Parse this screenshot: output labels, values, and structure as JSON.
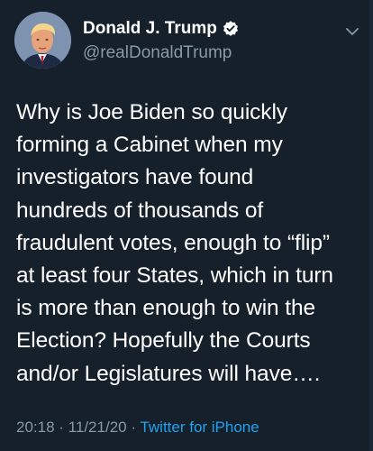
{
  "tweet": {
    "author": {
      "display_name": "Donald J. Trump",
      "handle": "@realDonaldTrump",
      "verified": true,
      "avatar_icon": "profile-photo"
    },
    "text_lines": [
      "Why is Joe Biden so quickly",
      "forming a Cabinet when my",
      "investigators have found",
      "hundreds of thousands of",
      "fraudulent votes, enough to “flip”",
      "at least four States, which in turn",
      "is more than enough to win the",
      "Election? Hopefully the Courts",
      "and/or Legislatures will have…."
    ],
    "time": "20:18",
    "date": "11/21/20",
    "separator": "·",
    "source": "Twitter for iPhone"
  },
  "colors": {
    "background": "#15202b",
    "text": "#ffffff",
    "secondary": "#8899a6",
    "link": "#1da1f2"
  }
}
